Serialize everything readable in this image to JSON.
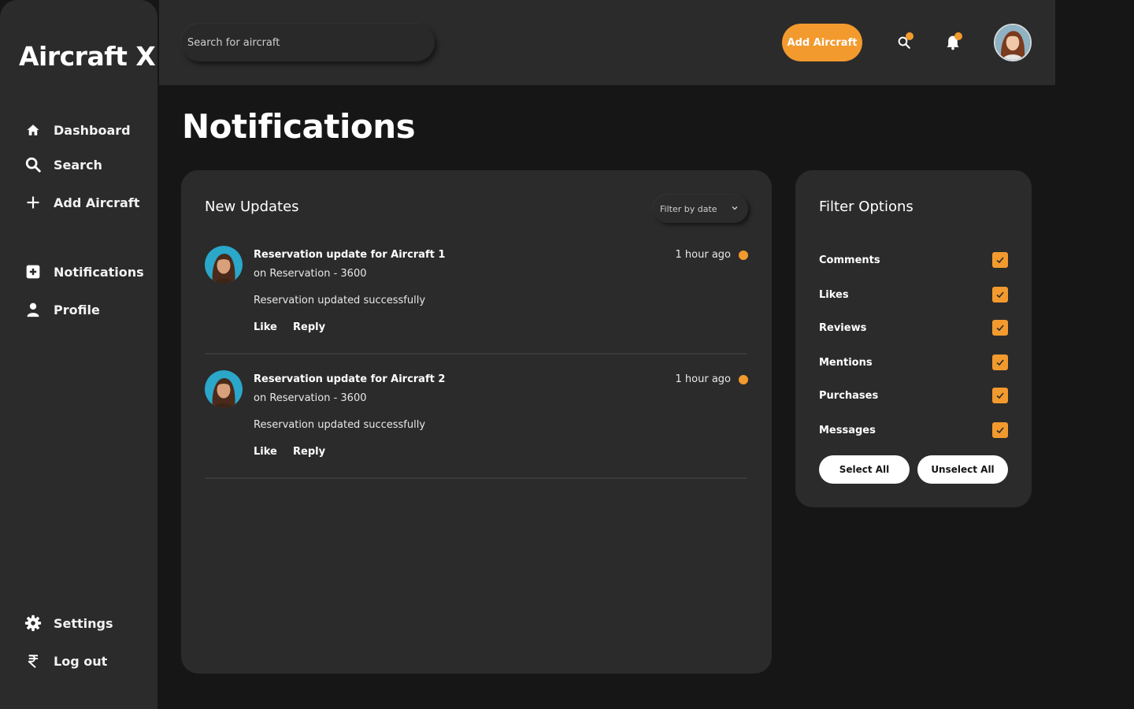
{
  "app": {
    "brand": "Aircraft X"
  },
  "sidebar": {
    "items": [
      {
        "label": "Dashboard",
        "icon": "home-icon"
      },
      {
        "label": "Search",
        "icon": "search-icon"
      },
      {
        "label": "Add Aircraft",
        "icon": "plus-icon"
      },
      {
        "label": "Notifications",
        "icon": "notification-square-icon"
      },
      {
        "label": "Profile",
        "icon": "user-icon"
      },
      {
        "label": "Settings",
        "icon": "gear-icon"
      },
      {
        "label": "Log out",
        "icon": "rupee-icon"
      }
    ]
  },
  "topbar": {
    "search_placeholder": "Search for aircraft",
    "add_button": "Add Aircraft",
    "icons": [
      "search-icon",
      "bell-icon"
    ],
    "accent": "#f29a2e"
  },
  "page": {
    "title": "Notifications"
  },
  "updates": {
    "title": "New Updates",
    "filter_label": "Filter by date",
    "items": [
      {
        "title": "Reservation update for Aircraft 1",
        "subtitle": "on Reservation - 3600",
        "body": "Reservation updated successfully",
        "time": "1 hour ago",
        "like": "Like",
        "reply": "Reply"
      },
      {
        "title": "Reservation update for Aircraft 2",
        "subtitle": "on Reservation - 3600",
        "body": "Reservation updated successfully",
        "time": "1 hour ago",
        "like": "Like",
        "reply": "Reply"
      }
    ]
  },
  "filters": {
    "title": "Filter Options",
    "options": [
      {
        "label": "Comments",
        "checked": true
      },
      {
        "label": "Likes",
        "checked": true
      },
      {
        "label": "Reviews",
        "checked": true
      },
      {
        "label": "Mentions",
        "checked": true
      },
      {
        "label": "Purchases",
        "checked": true
      },
      {
        "label": "Messages",
        "checked": true
      }
    ],
    "select_all": "Select All",
    "unselect_all": "Unselect All"
  }
}
